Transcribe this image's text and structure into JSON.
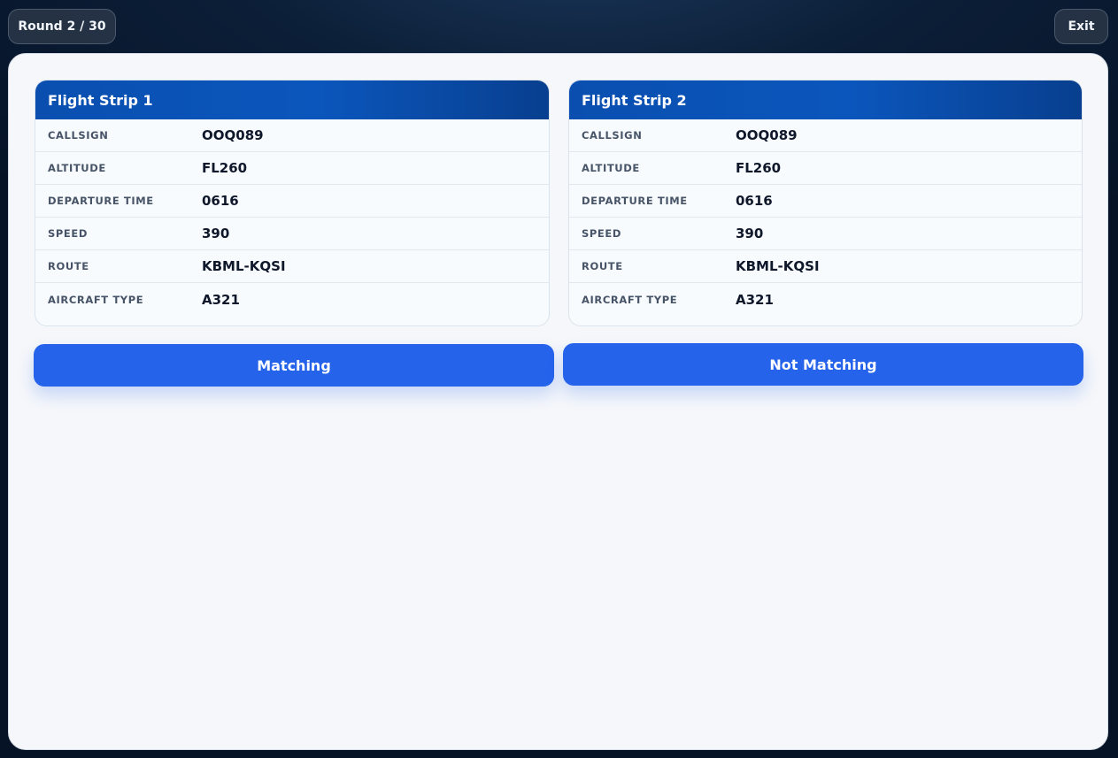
{
  "header": {
    "round_label": "Round 2 / 30",
    "exit_label": "Exit"
  },
  "strips": [
    {
      "title": "Flight Strip 1",
      "fields": [
        {
          "label": "CALLSIGN",
          "value": "OOQ089"
        },
        {
          "label": "ALTITUDE",
          "value": "FL260"
        },
        {
          "label": "DEPARTURE TIME",
          "value": "0616"
        },
        {
          "label": "SPEED",
          "value": "390"
        },
        {
          "label": "ROUTE",
          "value": "KBML-KQSI"
        },
        {
          "label": "AIRCRAFT TYPE",
          "value": "A321"
        }
      ]
    },
    {
      "title": "Flight Strip 2",
      "fields": [
        {
          "label": "CALLSIGN",
          "value": "OOQ089"
        },
        {
          "label": "ALTITUDE",
          "value": "FL260"
        },
        {
          "label": "DEPARTURE TIME",
          "value": "0616"
        },
        {
          "label": "SPEED",
          "value": "390"
        },
        {
          "label": "ROUTE",
          "value": "KBML-KQSI"
        },
        {
          "label": "AIRCRAFT TYPE",
          "value": "A321"
        }
      ]
    }
  ],
  "actions": {
    "matching_label": "Matching",
    "not_matching_label": "Not Matching"
  },
  "colors": {
    "accent": "#2563eb",
    "strip_header": "#0b56bc",
    "panel_bg": "#f5f7fa"
  }
}
